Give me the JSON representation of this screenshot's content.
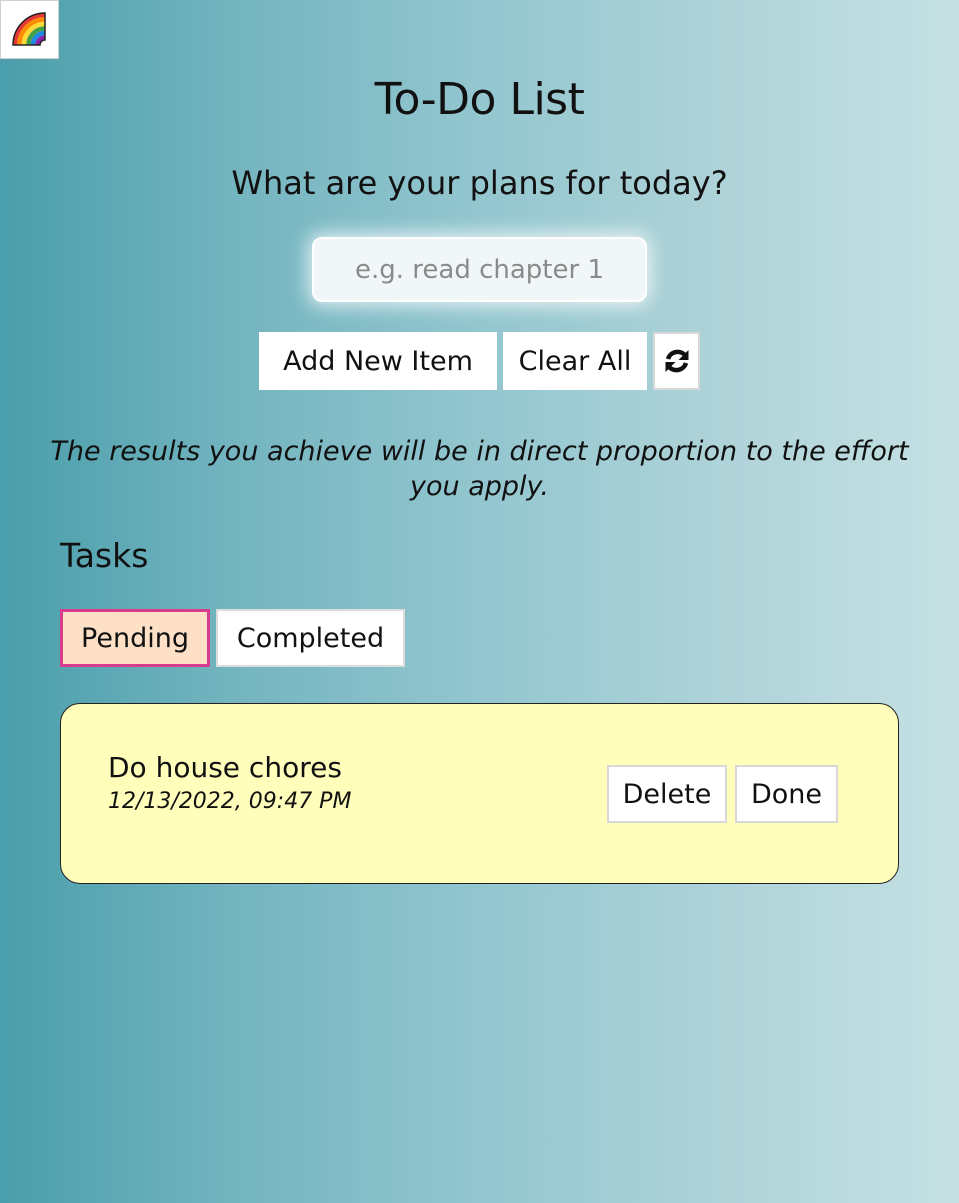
{
  "theme_toggle": {
    "icon": "rainbow-icon"
  },
  "header": {
    "title": "To-Do List",
    "subtitle": "What are your plans for today?"
  },
  "input": {
    "value": "",
    "placeholder": "e.g. read chapter 1"
  },
  "actions": {
    "add_label": "Add New Item",
    "clear_label": "Clear All",
    "refresh_icon": "refresh-icon"
  },
  "quote": "The results you achieve will be in direct proportion to the effort you apply.",
  "tasks": {
    "heading": "Tasks",
    "tabs": [
      {
        "label": "Pending",
        "active": true
      },
      {
        "label": "Completed",
        "active": false
      }
    ],
    "items": [
      {
        "text": "Do house chores",
        "timestamp": "12/13/2022, 09:47 PM",
        "delete_label": "Delete",
        "done_label": "Done"
      }
    ]
  },
  "colors": {
    "card_background": "#fffebb",
    "active_tab_background": "#fde0c5",
    "active_tab_border": "#d83c8e"
  }
}
